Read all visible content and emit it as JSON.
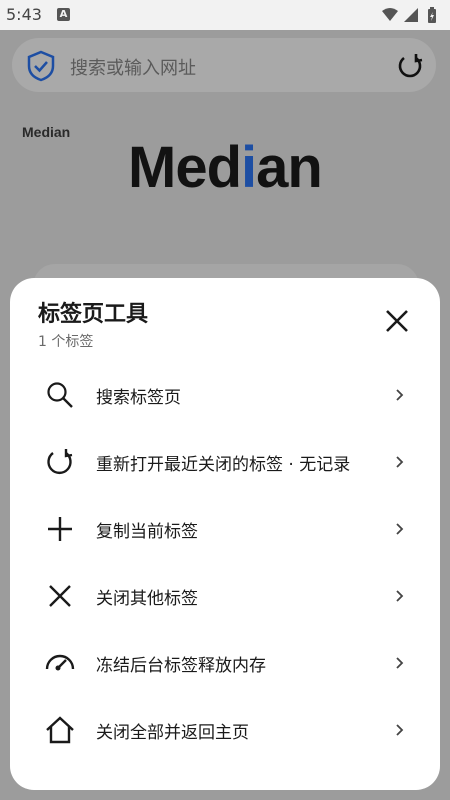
{
  "status_bar": {
    "time": "5:43",
    "notification_badge": "A"
  },
  "browser": {
    "url_placeholder": "搜索或输入网址",
    "site_label": "Median",
    "logo_prefix": "Med",
    "logo_accent": "i",
    "logo_suffix": "an",
    "logo_accent_color": "#1d4ea3"
  },
  "sheet": {
    "title": "标签页工具",
    "subtitle": "1 个标签",
    "items": [
      {
        "label": "搜索标签页",
        "icon": "search-icon"
      },
      {
        "label": "重新打开最近关闭的标签 · 无记录",
        "icon": "reopen-icon"
      },
      {
        "label": "复制当前标签",
        "icon": "plus-icon"
      },
      {
        "label": "关闭其他标签",
        "icon": "close-x-icon"
      },
      {
        "label": "冻结后台标签释放内存",
        "icon": "gauge-icon"
      },
      {
        "label": "关闭全部并返回主页",
        "icon": "home-icon"
      }
    ]
  }
}
